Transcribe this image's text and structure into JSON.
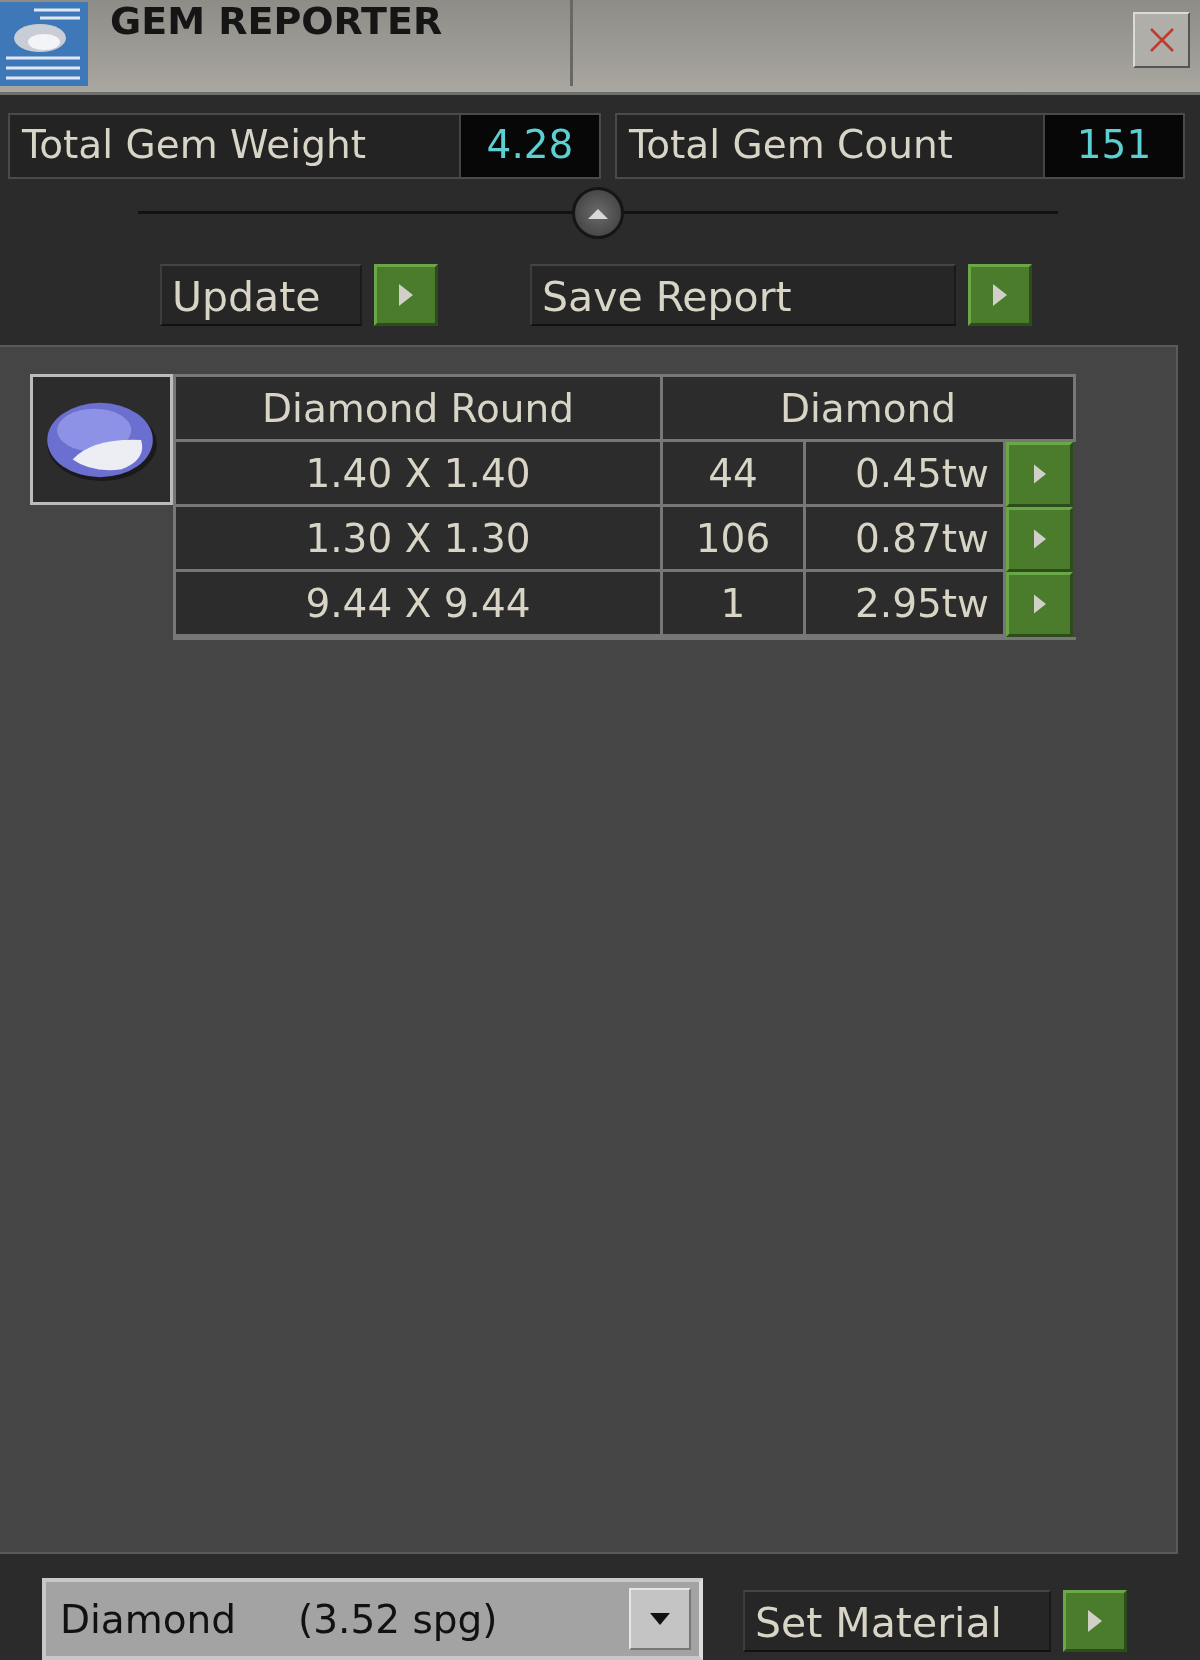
{
  "window": {
    "title": "GEM REPORTER"
  },
  "stats": [
    {
      "label": "Total Gem Weight",
      "value": "4.28"
    },
    {
      "label": "Total Gem Count",
      "value": "151"
    }
  ],
  "actions": [
    {
      "label": "Update"
    },
    {
      "label": "Save Report"
    }
  ],
  "table": {
    "headers": [
      "Diamond Round",
      "Diamond"
    ],
    "rows": [
      {
        "size": "1.40 X 1.40",
        "count": "44",
        "weight": "0.45tw"
      },
      {
        "size": "1.30 X 1.30",
        "count": "106",
        "weight": "0.87tw"
      },
      {
        "size": "9.44 X 9.44",
        "count": "1",
        "weight": "2.95tw"
      }
    ]
  },
  "material_select": {
    "value": "Diamond     (3.52 spg)"
  },
  "set_material": {
    "label": "Set Material"
  }
}
